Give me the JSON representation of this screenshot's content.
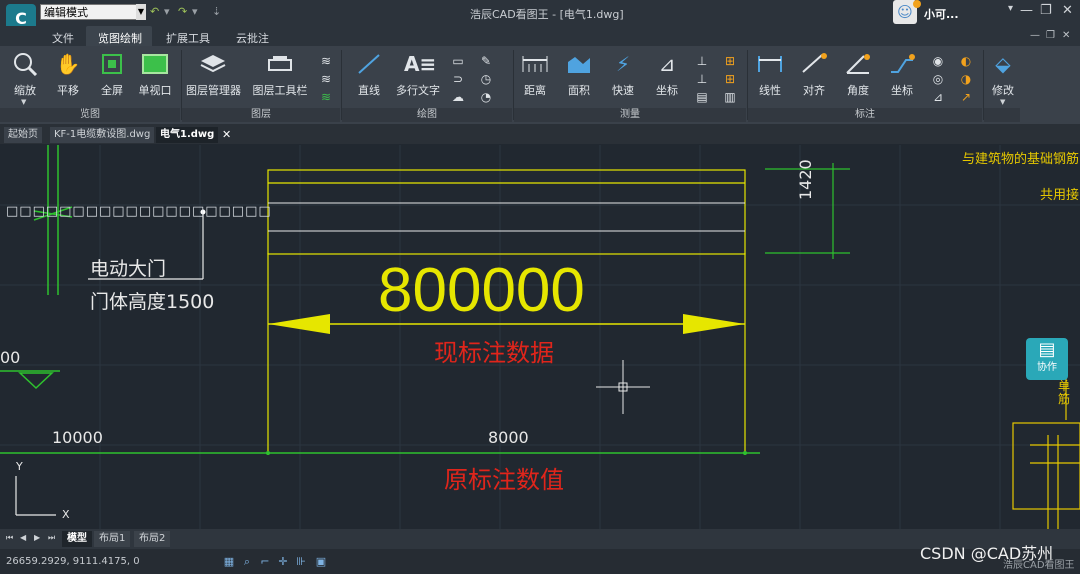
{
  "app": {
    "logo": "C",
    "mode": "编辑模式",
    "title": "浩辰CAD看图王 - [电气1.dwg]",
    "user_name": "小可...",
    "footer_brand": "浩辰CAD看图王",
    "watermark": "CSDN @CAD苏州"
  },
  "menu": [
    "文件",
    "览图绘制",
    "扩展工具",
    "云批注"
  ],
  "ribbon": {
    "groups": [
      "览图",
      "图层",
      "绘图",
      "测量",
      "标注"
    ],
    "buttons": {
      "zoom": "缩放",
      "pan": "平移",
      "fullscreen": "全屏",
      "single_viewport": "单视口",
      "layer_manager": "图层管理器",
      "layer_toolbar": "图层工具栏",
      "line": "直线",
      "mtext": "多行文字",
      "distance": "距离",
      "area": "面积",
      "quick": "快速",
      "coord": "坐标",
      "linear": "线性",
      "aligned": "对齐",
      "angle": "角度",
      "coord_dim": "坐标",
      "modify": "修改"
    }
  },
  "doc_tabs": [
    "起始页",
    "KF-1电缆敷设图.dwg",
    "电气1.dwg"
  ],
  "drawing": {
    "dotted_label": "□□□□□□□□□□□□□□□□□□□□",
    "gate_line1": "电动大门",
    "gate_line2": "门体高度1500",
    "big_dim": "800000",
    "annot_new": "现标注数据",
    "dim_10000": "10000",
    "dim_8000": "8000",
    "annot_orig": "原标注数值",
    "dim_1420": "1420",
    "left_cut": "00",
    "top_right_1": "与建筑物的基础钢筋",
    "top_right_2": "共用接",
    "right_vertical": "单筋",
    "ucs_x": "X",
    "ucs_y": "Y",
    "collab": "协作"
  },
  "layout_tabs": [
    "模型",
    "布局1",
    "布局2"
  ],
  "status": {
    "coords": "26659.2929, 9111.4175, 0"
  },
  "colors": {
    "dimension_yellow": "#e6e600",
    "annotation_red": "#e0251b",
    "dim_arrow_green": "#2ec12e",
    "background": "#212830"
  }
}
